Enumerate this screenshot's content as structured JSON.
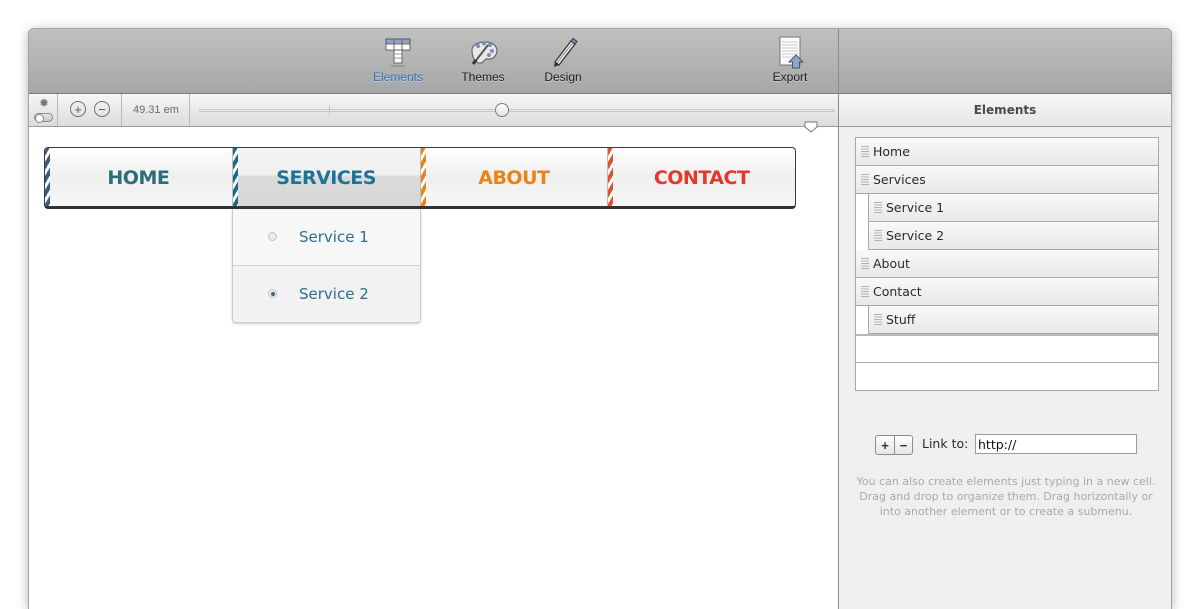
{
  "toolbar": {
    "buttons": [
      {
        "id": "elements",
        "label": "Elements",
        "icon": "table-icon",
        "active": true
      },
      {
        "id": "themes",
        "label": "Themes",
        "icon": "palette-icon",
        "active": false
      },
      {
        "id": "design",
        "label": "Design",
        "icon": "pencil-icon",
        "active": false
      },
      {
        "id": "export",
        "label": "Export",
        "icon": "export-document-icon",
        "active": false
      }
    ]
  },
  "ruler": {
    "settings_icon": "gear-icon",
    "zoom_in": "+",
    "zoom_out": "−",
    "width_value": "49.31 em"
  },
  "menu_preview": {
    "items": [
      {
        "label": "HOME",
        "color": "#2b6f7a",
        "stripe": "#3c5a7c",
        "selected": false
      },
      {
        "label": "SERVICES",
        "color": "#1d7396",
        "stripe": "#1d6a86",
        "selected": true
      },
      {
        "label": "ABOUT",
        "color": "#ea8414",
        "stripe": "#ea8414",
        "selected": false
      },
      {
        "label": "CONTACT",
        "color": "#e6382a",
        "stripe": "#e0532a",
        "selected": false
      }
    ],
    "dropdown": [
      {
        "label": "Service 1",
        "checked": false
      },
      {
        "label": "Service 2",
        "checked": true
      }
    ]
  },
  "side_panel": {
    "title": "Elements",
    "tree": [
      {
        "label": "Home",
        "level": 0
      },
      {
        "label": "Services",
        "level": 0
      },
      {
        "label": "Service 1",
        "level": 1
      },
      {
        "label": "Service 2",
        "level": 1
      },
      {
        "label": "About",
        "level": 0
      },
      {
        "label": "Contact",
        "level": 0
      },
      {
        "label": "Stuff",
        "level": 1
      }
    ],
    "add_label": "+",
    "remove_label": "−",
    "link_label": "Link to:",
    "link_value": "http://",
    "hint": "You can also create elements just typing in a new cell. Drag and drop to organize them. Drag horizontally or into another element or to create a submenu."
  }
}
